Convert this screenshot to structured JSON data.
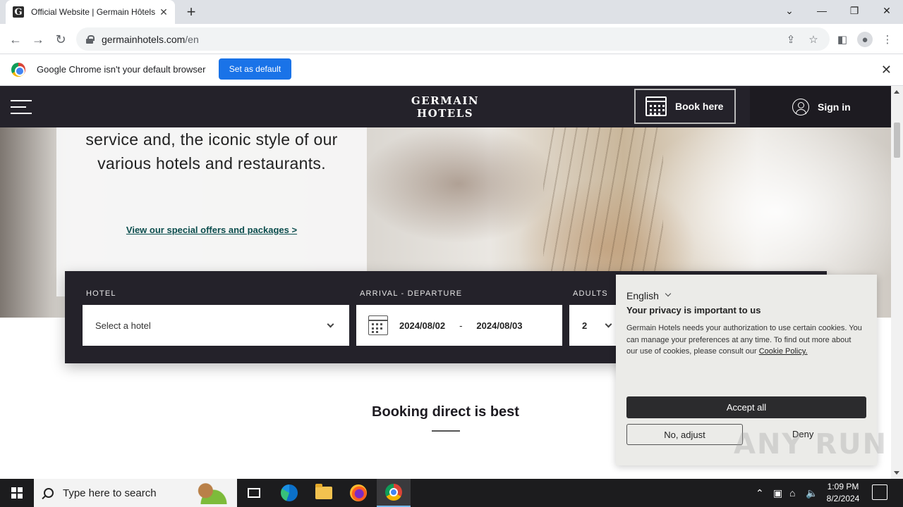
{
  "browser": {
    "tab_title": "Official Website | Germain Hôtels",
    "favicon_letter": "G",
    "url_host": "germainhotels.com",
    "url_path": "/en",
    "infobar_message": "Google Chrome isn't your default browser",
    "infobar_button": "Set as default"
  },
  "site": {
    "logo_line1": "GERMAIN",
    "logo_line2": "HOTELS",
    "book_here": "Book here",
    "sign_in": "Sign in"
  },
  "hero": {
    "text": "service and, the iconic style of our various hotels and restaurants.",
    "link": "View our special offers and packages >"
  },
  "booking": {
    "hotel_label": "HOTEL",
    "hotel_placeholder": "Select a hotel",
    "dates_label": "ARRIVAL - DEPARTURE",
    "arrival": "2024/08/02",
    "date_separator": "-",
    "departure": "2024/08/03",
    "adults_label": "ADULTS",
    "adults_value": "2",
    "section_title": "Booking direct is best"
  },
  "cookie": {
    "language": "English",
    "title": "Your privacy is important to us",
    "body": "Germain Hotels needs your authorization to use certain cookies. You can manage your preferences at any time. To find out more about our use of cookies, please consult our",
    "policy_link": "Cookie Policy.",
    "accept": "Accept all",
    "adjust": "No, adjust",
    "deny": "Deny"
  },
  "watermark": "ANY RUN",
  "taskbar": {
    "search_placeholder": "Type here to search",
    "time": "1:09 PM",
    "date": "8/2/2024"
  },
  "colors": {
    "header_bg": "#24222a",
    "chrome_blue": "#1a73e8",
    "accept_bg": "#2b2b2d"
  }
}
